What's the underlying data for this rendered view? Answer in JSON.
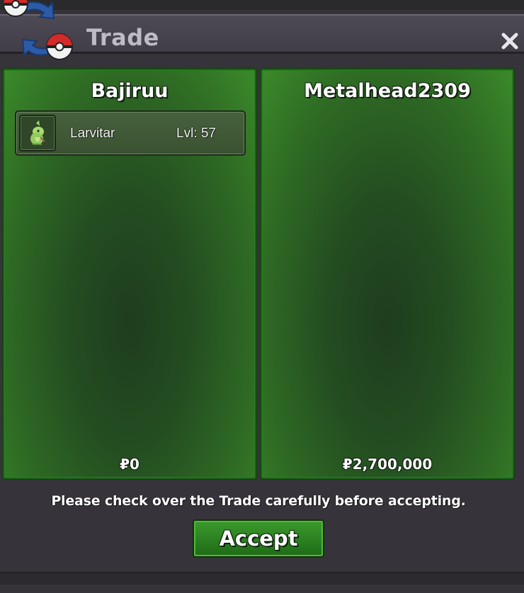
{
  "window": {
    "title": "Trade",
    "close_icon": "close-icon",
    "logo_icon": "trade-pokeball-arrows-icon"
  },
  "left_panel": {
    "player_name": "Bajiruu",
    "offer": [
      {
        "icon": "larvitar-sprite-icon",
        "name": "Larvitar",
        "level": "Lvl: 57"
      }
    ],
    "money": "₽0"
  },
  "right_panel": {
    "player_name": "Metalhead2309",
    "offer": [],
    "money": "₽2,700,000"
  },
  "notice": "Please check over the Trade carefully before accepting.",
  "accept_label": "Accept",
  "colors": {
    "panel_green": "#2f6c24",
    "button_green": "#2b8a20",
    "window_bg": "#37333a"
  }
}
